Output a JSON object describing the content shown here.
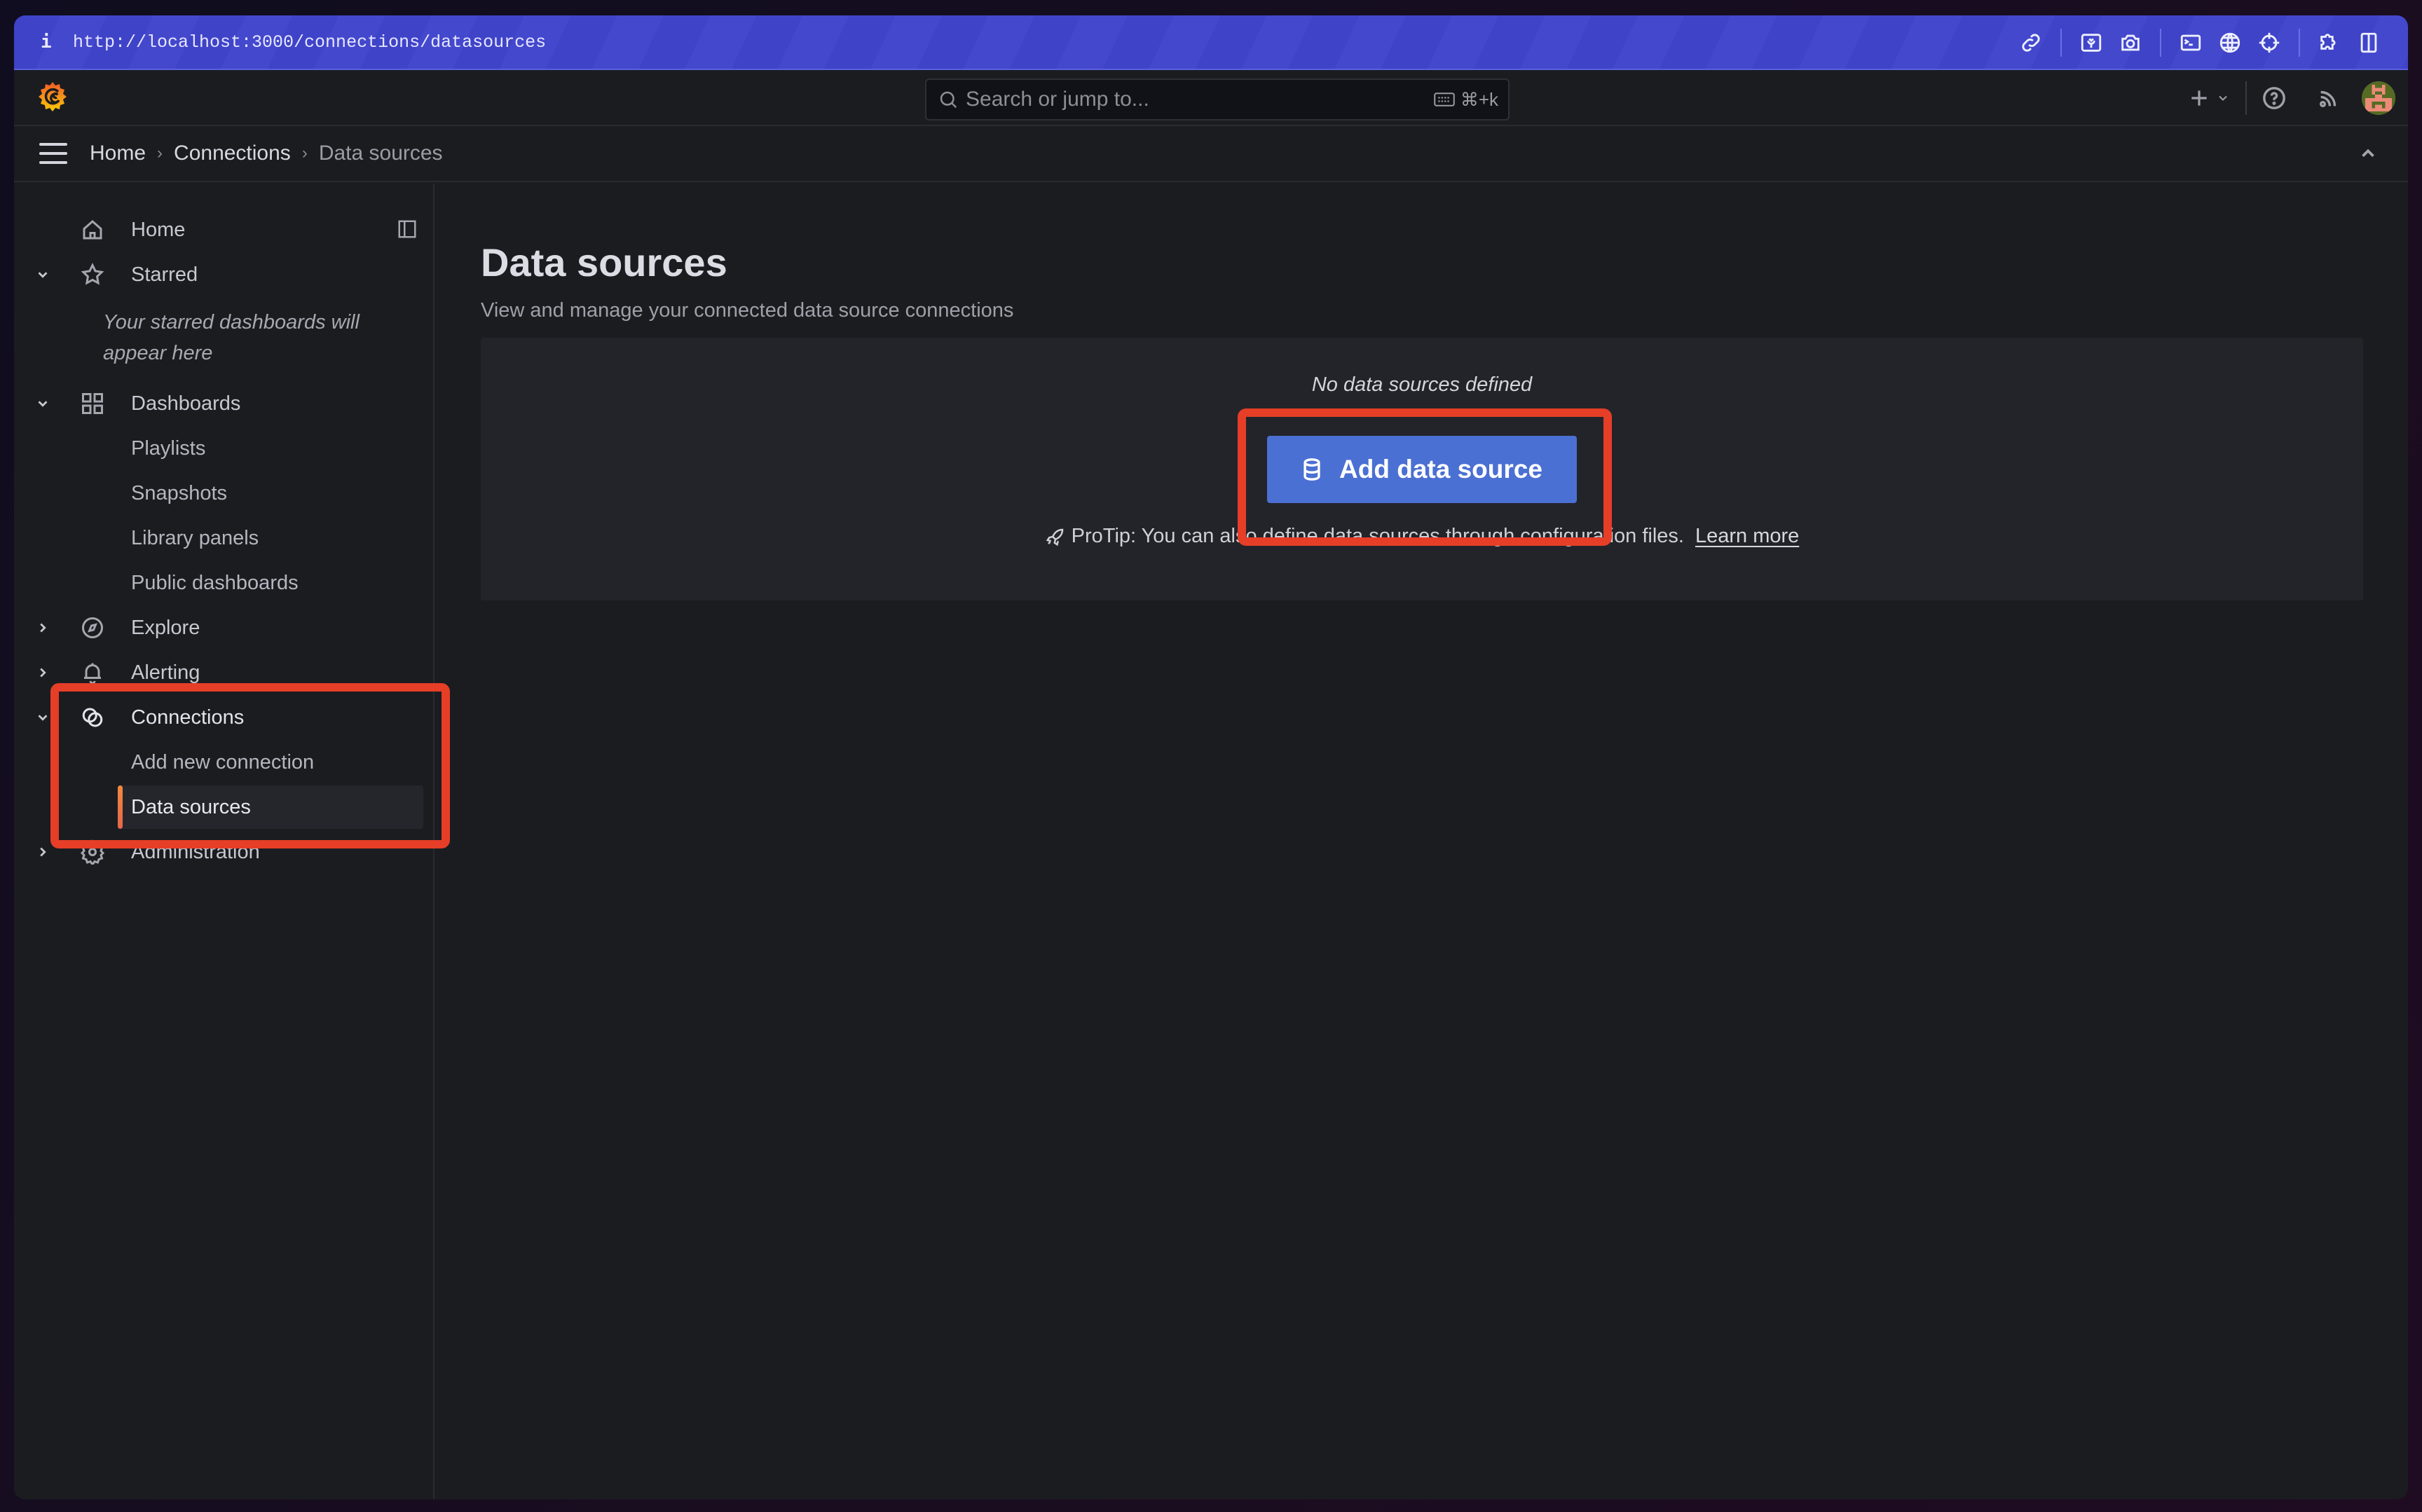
{
  "browser": {
    "info_glyph": "i",
    "url": "http://localhost:3000/connections/datasources",
    "toolbar_icons": [
      "link-icon",
      "picture-in-picture-icon",
      "camera-icon",
      "terminal-icon",
      "globe-icon",
      "crosshair-icon",
      "puzzle-extension-icon",
      "split-view-icon"
    ]
  },
  "topbar": {
    "logo": "grafana-logo",
    "search_placeholder": "Search or jump to...",
    "search_shortcut": "⌘+k",
    "new_button_icon": "plus-icon",
    "help_icon": "help-icon",
    "news_icon": "rss-icon",
    "avatar": "user-avatar"
  },
  "breadcrumb": {
    "items": [
      "Home",
      "Connections",
      "Data sources"
    ],
    "separator": "›"
  },
  "sidebar": {
    "items": [
      {
        "label": "Home",
        "icon": "home-icon",
        "expandable": false
      },
      {
        "label": "Starred",
        "icon": "star-icon",
        "expanded": true
      },
      {
        "label": "Dashboards",
        "icon": "dashboards-grid-icon",
        "expanded": true
      },
      {
        "label": "Playlists",
        "sub": true
      },
      {
        "label": "Snapshots",
        "sub": true
      },
      {
        "label": "Library panels",
        "sub": true
      },
      {
        "label": "Public dashboards",
        "sub": true
      },
      {
        "label": "Explore",
        "icon": "compass-icon",
        "expanded": false
      },
      {
        "label": "Alerting",
        "icon": "bell-icon",
        "expanded": false
      },
      {
        "label": "Connections",
        "icon": "connections-icon",
        "expanded": true
      },
      {
        "label": "Add new connection",
        "sub": true
      },
      {
        "label": "Data sources",
        "sub": true,
        "selected": true
      },
      {
        "label": "Administration",
        "icon": "gear-icon",
        "expanded": false
      }
    ],
    "starred_empty": "Your starred dashboards will appear here"
  },
  "main": {
    "title": "Data sources",
    "subtitle": "View and manage your connected data source connections",
    "empty_message": "No data sources defined",
    "add_button_label": "Add data source",
    "protip_text": "ProTip: You can also define data sources through configuration files.",
    "protip_link": "Learn more"
  },
  "colors": {
    "browser_bar": "#3f43c8",
    "background": "#1b1c20",
    "panel": "#232429",
    "primary_button": "#4b70d3",
    "active_indicator": "#f28a3d",
    "annotation": "#e63e27"
  }
}
